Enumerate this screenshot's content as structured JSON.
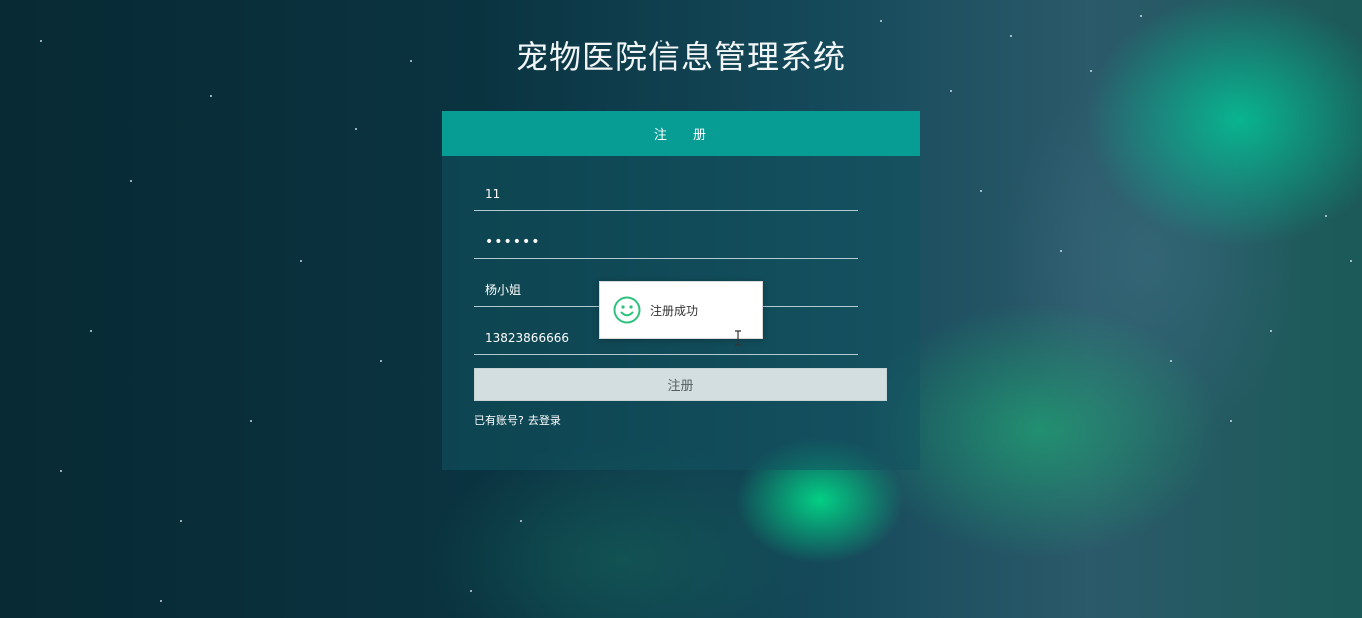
{
  "page": {
    "title": "宠物医院信息管理系统"
  },
  "register": {
    "header": "注 册",
    "username": "11",
    "password_masked": "••••••",
    "name": "杨小姐",
    "phone": "13823866666",
    "submit_label": "注册",
    "login_prompt": "已有账号?",
    "login_link": "去登录"
  },
  "toast": {
    "message": "注册成功",
    "icon": "smile-icon"
  },
  "colors": {
    "header_bg": "#079d95",
    "success_icon": "#2ec27e",
    "submit_bg": "#d2dee0"
  }
}
